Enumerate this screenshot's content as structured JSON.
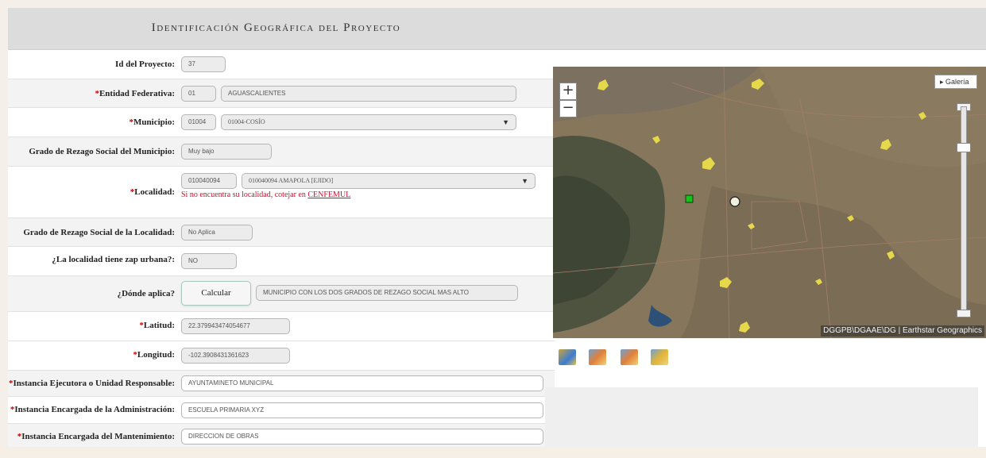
{
  "header": {
    "title": "Identificación Geográfica del Proyecto"
  },
  "form": {
    "rows": [
      {
        "id": "id_proyecto",
        "label": "Id del Proyecto:",
        "required": false,
        "value": "37"
      },
      {
        "id": "entidad",
        "label": "Entidad Federativa:",
        "required": true,
        "code": "01",
        "value": "AGUASCALIENTES"
      },
      {
        "id": "municipio",
        "label": "Municipio:",
        "required": true,
        "code": "01004",
        "selected": "01004-COSÍO"
      },
      {
        "id": "rezago_municipio",
        "label": "Grado de Rezago Social del Municipio:",
        "required": false,
        "value": "Muy bajo"
      },
      {
        "id": "localidad",
        "label": "Localidad:",
        "required": true,
        "code": "010040094",
        "selected": "010040094 AMAPOLA [EJIDO]",
        "help_text": "Si no encuentra su localidad, cotejar en ",
        "help_link": "CENFEMUL"
      },
      {
        "id": "rezago_localidad",
        "label": "Grado de Rezago Social de la Localidad:",
        "required": false,
        "value": "No Aplica"
      },
      {
        "id": "zap_urbana",
        "label": "¿La localidad tiene zap urbana?:",
        "required": false,
        "value": "NO"
      },
      {
        "id": "donde_aplica",
        "label": "¿Dónde aplica?",
        "required": false,
        "button": "Calcular",
        "value": "MUNICIPIO CON LOS DOS GRADOS DE REZAGO SOCIAL MAS ALTO"
      },
      {
        "id": "latitud",
        "label": "Latitud:",
        "required": true,
        "value": "22.379943474054677"
      },
      {
        "id": "longitud",
        "label": "Longitud:",
        "required": true,
        "value": "-102.3908431361623"
      },
      {
        "id": "instancia_ejecutora",
        "label": "Instancia Ejecutora o Unidad Responsable:",
        "required": true,
        "value": "AYUNTAMINETO MUNICIPAL"
      },
      {
        "id": "instancia_admin",
        "label": "Instancia Encargada de la Administración:",
        "required": true,
        "value": "ESCUELA PRIMARIA XYZ"
      },
      {
        "id": "instancia_mant",
        "label": "Instancia Encargada del Mantenimiento:",
        "required": true,
        "value": "DIRECCION DE OBRAS"
      }
    ]
  },
  "map": {
    "zoom_in": "+",
    "zoom_out": "−",
    "gallery_label": "▸ Galería",
    "attribution": "DGGPB\\DGAAE\\DG | Earthstar Geographics",
    "layer_icons": [
      "basemap-layer-icon",
      "layer-icon-2",
      "layer-icon-3",
      "layer-icon-4"
    ]
  },
  "colors": {
    "required_mark": "#cc0000",
    "link": "#c8102e",
    "title_bar": "#dcdcdc"
  }
}
